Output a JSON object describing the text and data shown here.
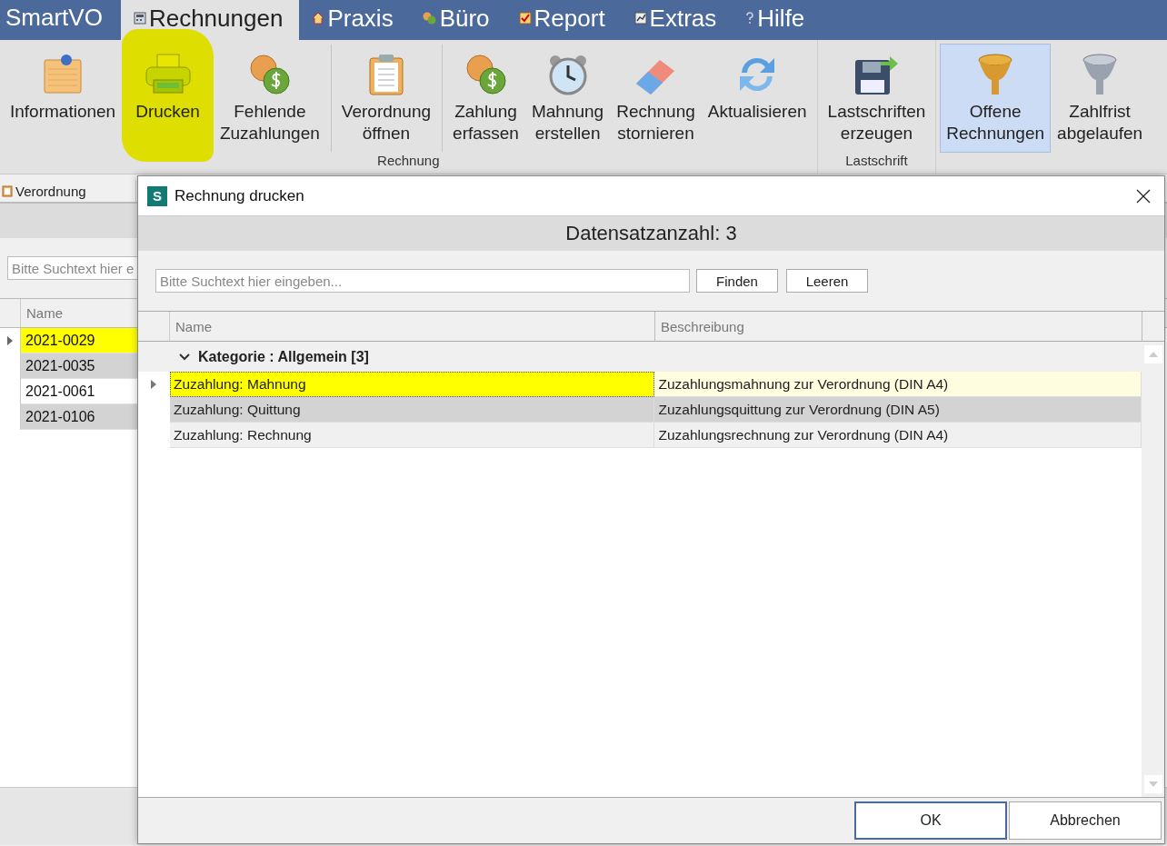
{
  "menu": {
    "app_title": "SmartVO",
    "tabs": [
      {
        "label": "Rechnungen",
        "selected": true
      },
      {
        "label": "Praxis",
        "selected": false
      },
      {
        "label": "Büro",
        "selected": false
      },
      {
        "label": "Report",
        "selected": false
      },
      {
        "label": "Extras",
        "selected": false
      },
      {
        "label": "Hilfe",
        "selected": false
      }
    ]
  },
  "ribbon": {
    "groups": [
      {
        "label": "Rechnung",
        "items": [
          {
            "lines": [
              "Informationen"
            ],
            "highlighted": false,
            "selected": false,
            "separator_before": false
          },
          {
            "lines": [
              "Drucken"
            ],
            "highlighted": true,
            "selected": false,
            "separator_before": false
          },
          {
            "lines": [
              "Fehlende",
              "Zuzahlungen"
            ],
            "highlighted": false,
            "selected": false,
            "separator_before": false
          },
          {
            "lines": [
              "Verordnung",
              "öffnen"
            ],
            "highlighted": false,
            "selected": false,
            "separator_before": true
          },
          {
            "lines": [
              "Zahlung",
              "erfassen"
            ],
            "highlighted": false,
            "selected": false,
            "separator_before": true
          },
          {
            "lines": [
              "Mahnung",
              "erstellen"
            ],
            "highlighted": false,
            "selected": false,
            "separator_before": false
          },
          {
            "lines": [
              "Rechnung",
              "stornieren"
            ],
            "highlighted": false,
            "selected": false,
            "separator_before": false
          },
          {
            "lines": [
              "Aktualisieren"
            ],
            "highlighted": false,
            "selected": false,
            "separator_before": false
          }
        ]
      },
      {
        "label": "Lastschrift",
        "items": [
          {
            "lines": [
              "Lastschriften",
              "erzeugen"
            ],
            "highlighted": false,
            "selected": false,
            "separator_before": false
          }
        ]
      },
      {
        "items": [
          {
            "lines": [
              "Offene",
              "Rechnungen"
            ],
            "highlighted": false,
            "selected": true,
            "separator_before": false
          },
          {
            "lines": [
              "Zahlfrist",
              "abgelaufen"
            ],
            "highlighted": false,
            "selected": false,
            "separator_before": false
          }
        ]
      }
    ]
  },
  "left_panel": {
    "tab": {
      "label": "Verordnung"
    },
    "search": {
      "placeholder": "Bitte Suchtext hier e"
    },
    "columns": [
      "Name"
    ],
    "rows": [
      {
        "name": "2021-0029",
        "selected": true
      },
      {
        "name": "2021-0035",
        "selected": false
      },
      {
        "name": "2021-0061",
        "selected": false
      },
      {
        "name": "2021-0106",
        "selected": false
      }
    ]
  },
  "dialog": {
    "badge": "S",
    "title": "Rechnung drucken",
    "record_count": "Datensatzanzahl: 3",
    "search": {
      "placeholder": "Bitte Suchtext hier eingeben..."
    },
    "search_buttons": [
      "Finden",
      "Leeren"
    ],
    "columns": [
      "Name",
      "Beschreibung"
    ],
    "group": {
      "label": "Kategorie : Allgemein [3]",
      "expanded": true,
      "rows": [
        {
          "name": "Zuzahlung: Mahnung",
          "description": "Zuzahlungsmahnung zur Verordnung (DIN A4)",
          "selected": true
        },
        {
          "name": "Zuzahlung: Quittung",
          "description": "Zuzahlungsquittung zur Verordnung (DIN A5)",
          "selected": false
        },
        {
          "name": "Zuzahlung: Rechnung",
          "description": "Zuzahlungsrechnung zur Verordnung (DIN A4)",
          "selected": false
        }
      ]
    },
    "buttons": [
      {
        "label": "OK",
        "default": true
      },
      {
        "label": "Abbrechen",
        "default": false
      }
    ]
  }
}
